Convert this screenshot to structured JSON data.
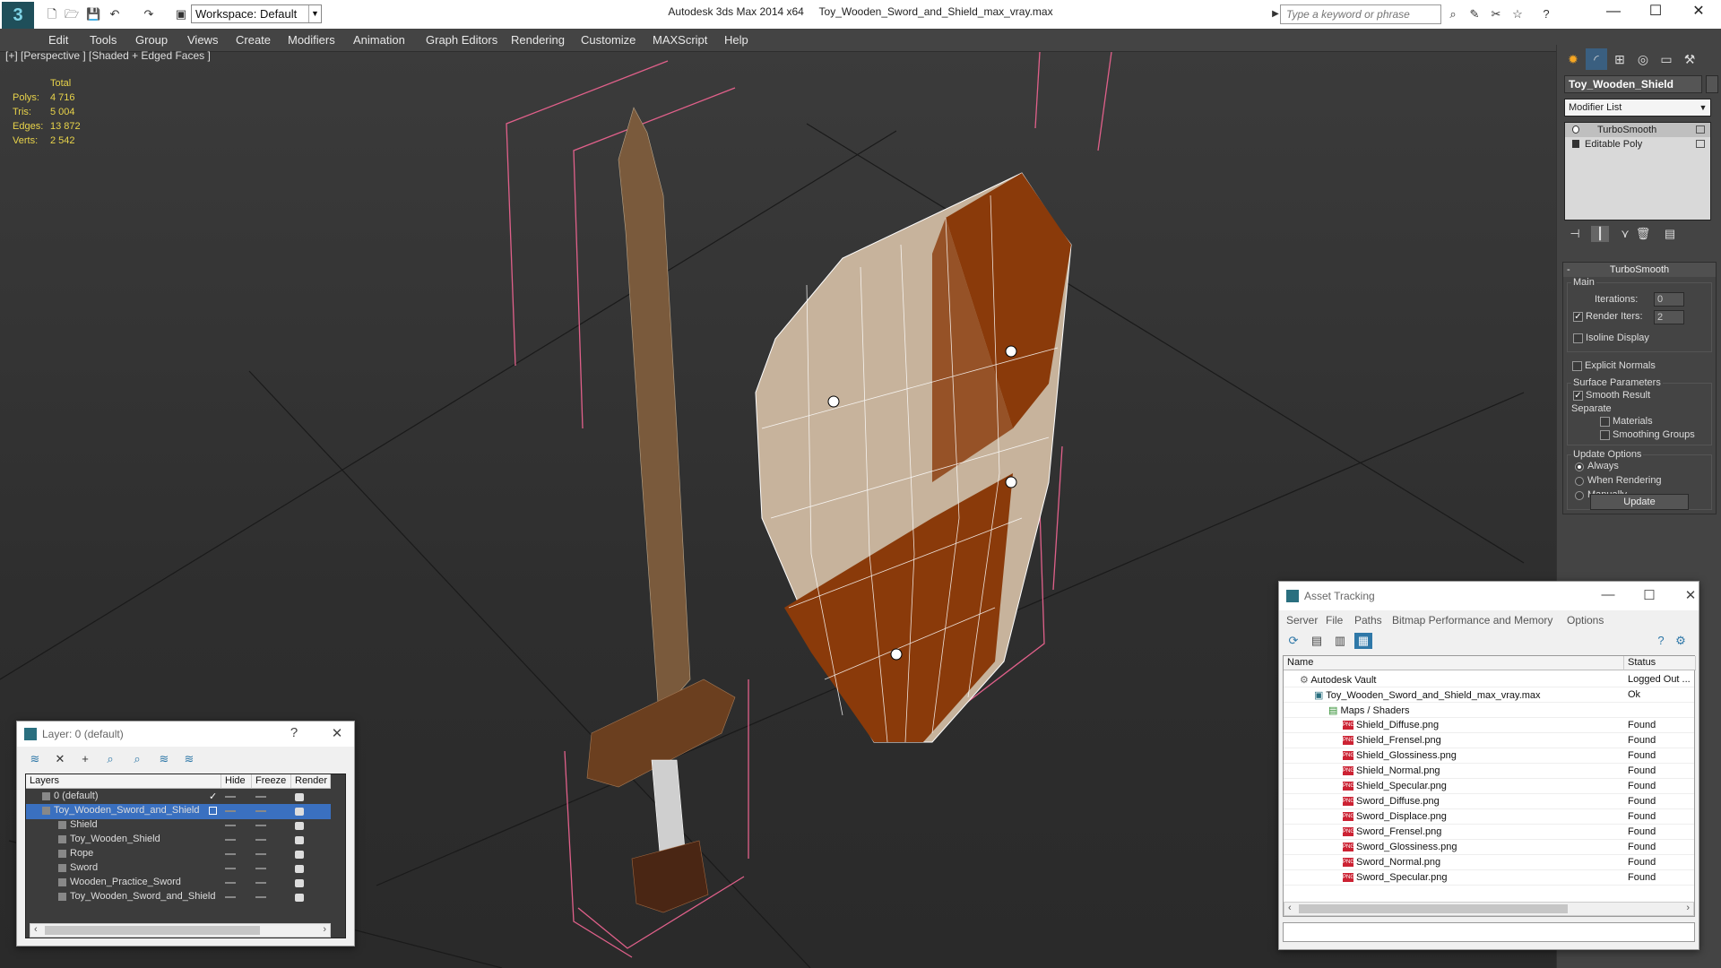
{
  "titlebar": {
    "app_title": "Autodesk 3ds Max  2014 x64",
    "file_title": "Toy_Wooden_Sword_and_Shield_max_vray.max",
    "workspace": "Workspace: Default",
    "search_placeholder": "Type a keyword or phrase"
  },
  "menu": [
    "Edit",
    "Tools",
    "Group",
    "Views",
    "Create",
    "Modifiers",
    "Animation",
    "Graph Editors",
    "Rendering",
    "Customize",
    "MAXScript",
    "Help"
  ],
  "viewport": {
    "label": "[+] [Perspective ] [Shaded + Edged Faces ]",
    "stats_header": "Total",
    "stats": [
      {
        "k": "Polys:",
        "v": "4 716"
      },
      {
        "k": "Tris:",
        "v": "5 004"
      },
      {
        "k": "Edges:",
        "v": "13 872"
      },
      {
        "k": "Verts:",
        "v": "2 542"
      }
    ]
  },
  "command_panel": {
    "object_name": "Toy_Wooden_Shield",
    "modifier_list": "Modifier List",
    "stack": [
      "TurboSmooth",
      "Editable Poly"
    ],
    "rollout_title": "TurboSmooth",
    "main_group": "Main",
    "iterations_label": "Iterations:",
    "iterations_value": "0",
    "render_iters_label": "Render Iters:",
    "render_iters_value": "2",
    "isoline": "Isoline Display",
    "explicit_normals": "Explicit Normals",
    "surface_group": "Surface Parameters",
    "smooth_result": "Smooth Result",
    "separate": "Separate",
    "materials": "Materials",
    "smoothing_groups": "Smoothing Groups",
    "update_group": "Update Options",
    "always": "Always",
    "when_rendering": "When Rendering",
    "manually": "Manually",
    "update_button": "Update"
  },
  "layers": {
    "title": "Layer: 0 (default)",
    "help": "?",
    "columns": [
      "Layers",
      "Hide",
      "Freeze",
      "Render"
    ],
    "rows": [
      {
        "name": "0 (default)",
        "indent": 1,
        "selected": false
      },
      {
        "name": "Toy_Wooden_Sword_and_Shield",
        "indent": 1,
        "selected": true
      },
      {
        "name": "Shield",
        "indent": 2,
        "selected": false
      },
      {
        "name": "Toy_Wooden_Shield",
        "indent": 2,
        "selected": false
      },
      {
        "name": "Rope",
        "indent": 2,
        "selected": false
      },
      {
        "name": "Sword",
        "indent": 2,
        "selected": false
      },
      {
        "name": "Wooden_Practice_Sword",
        "indent": 2,
        "selected": false
      },
      {
        "name": "Toy_Wooden_Sword_and_Shield",
        "indent": 2,
        "selected": false
      }
    ]
  },
  "asset_tracking": {
    "title": "Asset Tracking",
    "menu": [
      "Server",
      "File",
      "Paths",
      "Bitmap Performance and Memory",
      "Options"
    ],
    "columns": [
      "Name",
      "Status"
    ],
    "rows": [
      {
        "name": "Autodesk Vault",
        "status": "Logged Out ...",
        "indent": 0,
        "type": "vault"
      },
      {
        "name": "Toy_Wooden_Sword_and_Shield_max_vray.max",
        "status": "Ok",
        "indent": 1,
        "type": "file"
      },
      {
        "name": "Maps / Shaders",
        "status": "",
        "indent": 2,
        "type": "folder"
      },
      {
        "name": "Shield_Diffuse.png",
        "status": "Found",
        "indent": 3,
        "type": "png"
      },
      {
        "name": "Shield_Frensel.png",
        "status": "Found",
        "indent": 3,
        "type": "png"
      },
      {
        "name": "Shield_Glossiness.png",
        "status": "Found",
        "indent": 3,
        "type": "png"
      },
      {
        "name": "Shield_Normal.png",
        "status": "Found",
        "indent": 3,
        "type": "png"
      },
      {
        "name": "Shield_Specular.png",
        "status": "Found",
        "indent": 3,
        "type": "png"
      },
      {
        "name": "Sword_Diffuse.png",
        "status": "Found",
        "indent": 3,
        "type": "png"
      },
      {
        "name": "Sword_Displace.png",
        "status": "Found",
        "indent": 3,
        "type": "png"
      },
      {
        "name": "Sword_Frensel.png",
        "status": "Found",
        "indent": 3,
        "type": "png"
      },
      {
        "name": "Sword_Glossiness.png",
        "status": "Found",
        "indent": 3,
        "type": "png"
      },
      {
        "name": "Sword_Normal.png",
        "status": "Found",
        "indent": 3,
        "type": "png"
      },
      {
        "name": "Sword_Specular.png",
        "status": "Found",
        "indent": 3,
        "type": "png"
      }
    ]
  },
  "colors": {
    "accent": "#3399ff",
    "stats": "#e8d34a",
    "selection_box": "#e0608a"
  }
}
